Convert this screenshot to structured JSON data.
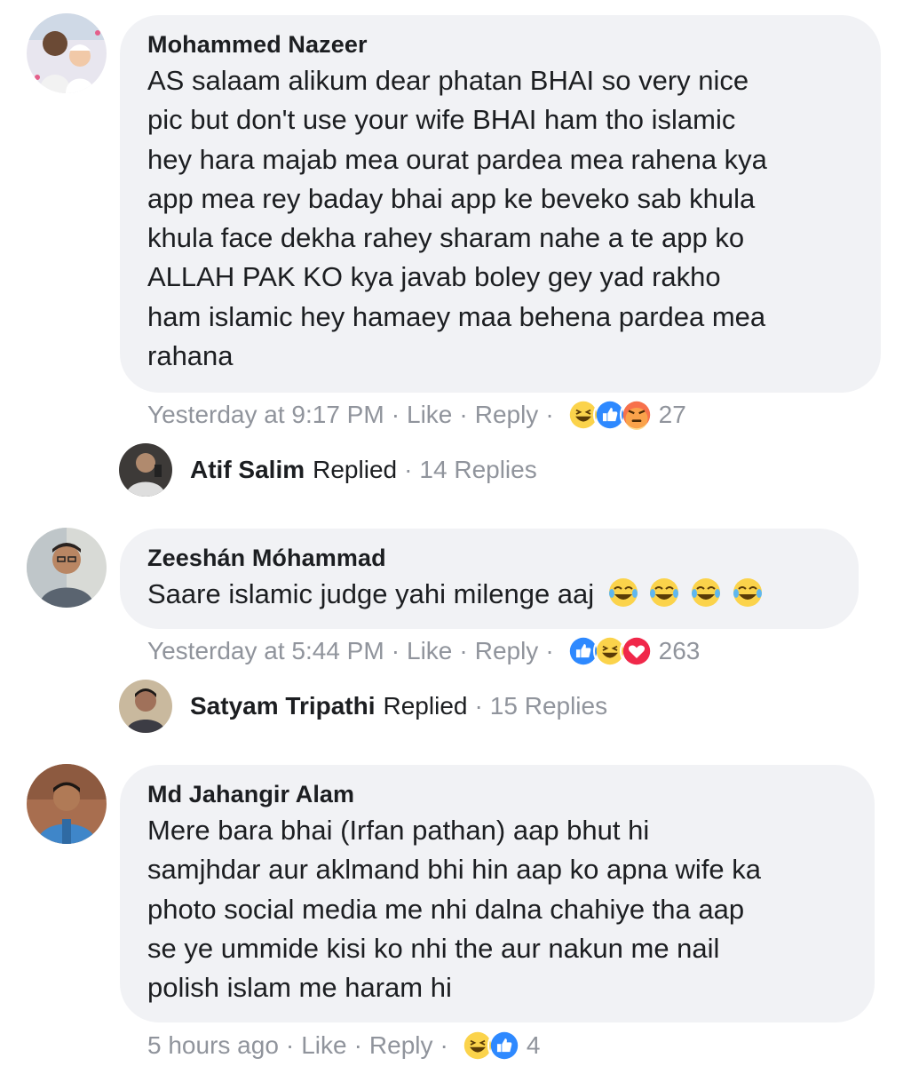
{
  "comments": [
    {
      "author": "Mohammed Nazeer",
      "text": "AS salaam alikum dear phatan  BHAI so very nice\npic but don't use your wife BHAI ham tho islamic\nhey hara majab mea ourat pardea mea rahena kya\napp mea rey baday bhai app ke beveko sab khula\nkhula face dekha rahey sharam nahe a te app ko\nALLAH PAK KO kya javab boley gey yad rakho\nham islamic hey hamaey maa behena pardea mea\nrahana",
      "time": "Yesterday at 9:17 PM",
      "like": "Like",
      "reply": "Reply",
      "reactions": [
        "haha",
        "like",
        "angry"
      ],
      "reaction_count": "27",
      "replied": {
        "name": "Atif Salim",
        "word": "Replied",
        "count": "14 Replies"
      }
    },
    {
      "author": "Zeeshán Móhammad",
      "text": "Saare islamic judge yahi milenge aaj",
      "text_emoji": [
        "joy-emoji",
        "joy-emoji",
        "joy-emoji",
        "joy-emoji"
      ],
      "time": "Yesterday at 5:44 PM",
      "like": "Like",
      "reply": "Reply",
      "reactions": [
        "like",
        "haha",
        "love"
      ],
      "reaction_count": "263",
      "replied": {
        "name": "Satyam Tripathi",
        "word": "Replied",
        "count": "15 Replies"
      }
    },
    {
      "author": "Md Jahangir Alam",
      "text": "Mere bara bhai (Irfan pathan)  aap bhut hi\nsamjhdar aur aklmand bhi hin aap ko apna wife ka\nphoto  social media me nhi dalna chahiye tha aap\nse ye ummide kisi ko nhi the aur nakun me nail\npolish islam me haram hi",
      "time": "5 hours ago",
      "like": "Like",
      "reply": "Reply",
      "reactions": [
        "haha",
        "like"
      ],
      "reaction_count": "4"
    }
  ],
  "separator": "·",
  "colors": {
    "bubble": "#f1f2f5",
    "meta": "#90949c",
    "text": "#1c1e21",
    "like_blue": "#2e89ff",
    "love_red": "#f0284a",
    "haha_yellow": "#fbd34b",
    "angry_red": "#f7714b"
  }
}
